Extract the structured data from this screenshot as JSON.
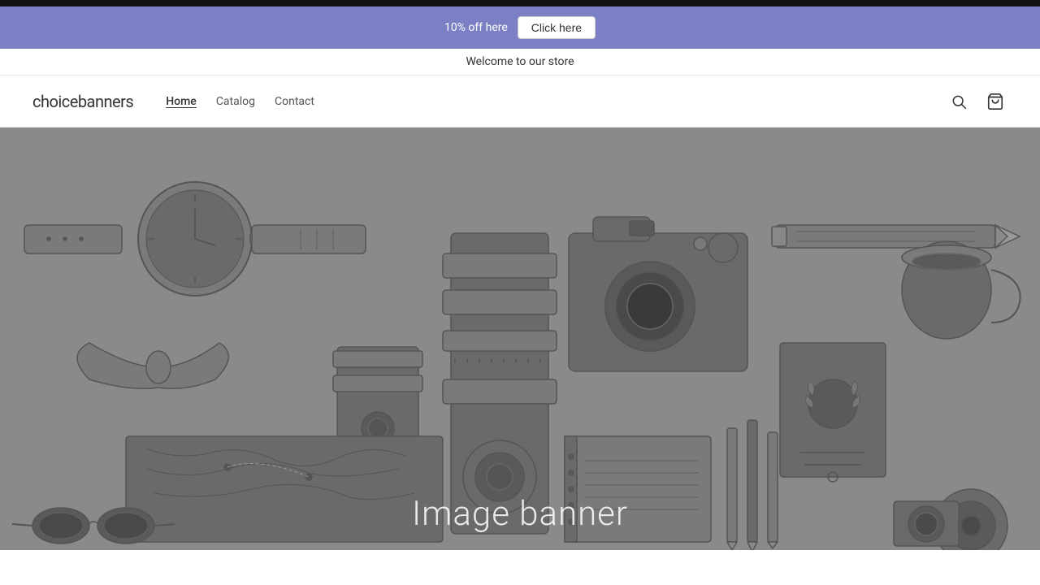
{
  "topBar": {
    "promoText": "10% off here",
    "ctaLabel": "Click here",
    "backgroundColor": "#7b7fc4"
  },
  "secondaryBar": {
    "text": "Welcome to our store"
  },
  "header": {
    "logo": "choicebanners",
    "nav": [
      {
        "label": "Home",
        "active": true
      },
      {
        "label": "Catalog",
        "active": false
      },
      {
        "label": "Contact",
        "active": false
      }
    ],
    "searchLabel": "Search",
    "cartLabel": "Cart"
  },
  "hero": {
    "bannerText": "Image banner",
    "backgroundColor": "#8a8a8a"
  }
}
